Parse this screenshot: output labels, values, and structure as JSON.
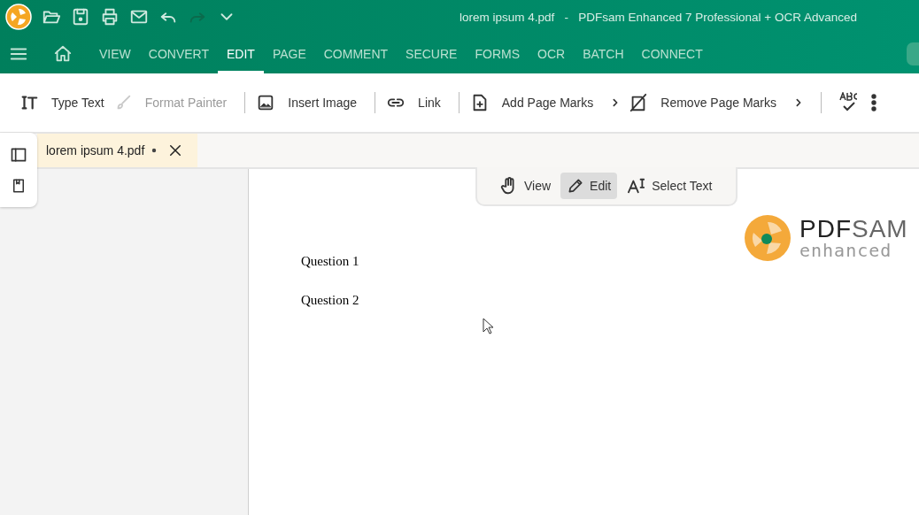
{
  "window": {
    "title": "lorem ipsum 4.pdf   -   PDFsam Enhanced 7 Professional + OCR Advanced"
  },
  "quick_access": [
    {
      "disabled": false
    },
    {
      "disabled": false
    },
    {
      "disabled": false
    },
    {
      "disabled": false
    },
    {
      "disabled": false
    },
    {
      "disabled": true
    },
    {
      "disabled": false
    }
  ],
  "menu_tabs": [
    {
      "label": "VIEW",
      "selected": false
    },
    {
      "label": "CONVERT",
      "selected": false
    },
    {
      "label": "EDIT",
      "selected": true
    },
    {
      "label": "PAGE",
      "selected": false
    },
    {
      "label": "COMMENT",
      "selected": false
    },
    {
      "label": "SECURE",
      "selected": false
    },
    {
      "label": "FORMS",
      "selected": false
    },
    {
      "label": "OCR",
      "selected": false
    },
    {
      "label": "BATCH",
      "selected": false
    },
    {
      "label": "CONNECT",
      "selected": false
    }
  ],
  "toolbar": [
    {
      "label": "Type Text",
      "disabled": false,
      "submenu": false,
      "separator_after": false
    },
    {
      "label": "Format Painter",
      "disabled": true,
      "submenu": false,
      "separator_after": true
    },
    {
      "label": "Insert Image",
      "disabled": false,
      "submenu": false,
      "separator_after": true
    },
    {
      "label": "Link",
      "disabled": false,
      "submenu": false,
      "separator_after": true
    },
    {
      "label": "Add Page Marks",
      "disabled": false,
      "submenu": true,
      "separator_after": false
    },
    {
      "label": "Remove Page Marks",
      "disabled": false,
      "submenu": true,
      "separator_after": true
    }
  ],
  "document_tab": {
    "label": "lorem ipsum 4.pdf",
    "modified": true
  },
  "modes": [
    {
      "label": "View",
      "selected": false
    },
    {
      "label": "Edit",
      "selected": true
    },
    {
      "label": "Select Text",
      "selected": false
    }
  ],
  "page": {
    "logo": {
      "dark": "PDF",
      "light": "SAM",
      "tagline": "enhanced"
    },
    "lines": [
      "Question 1",
      "Question 2"
    ]
  }
}
